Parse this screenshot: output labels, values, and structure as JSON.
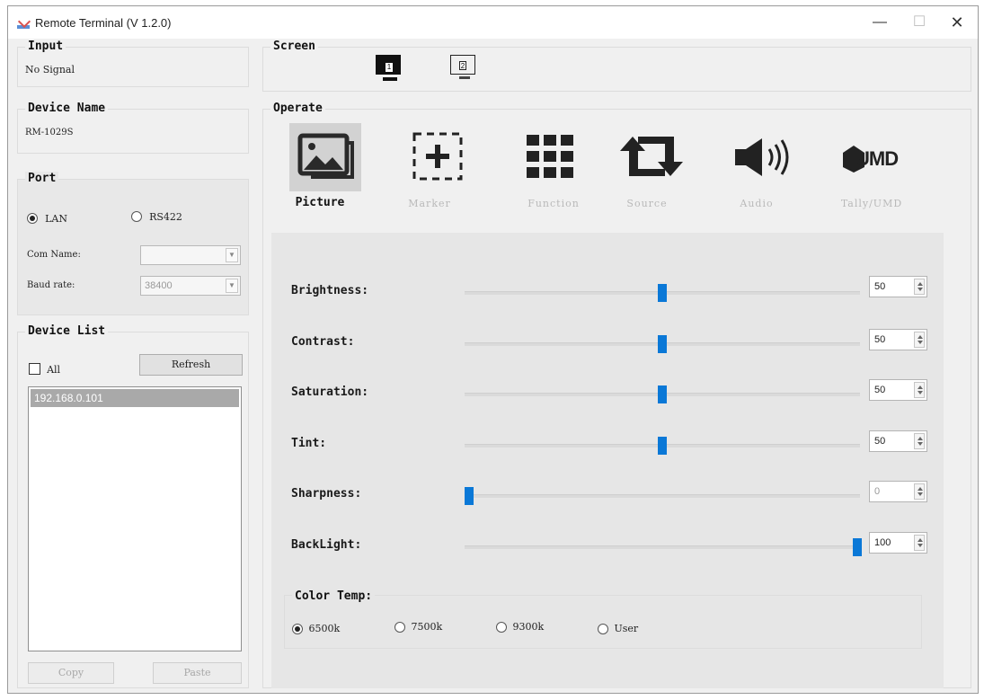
{
  "window": {
    "title": "Remote Terminal (V 1.2.0)",
    "minimize": "—",
    "maximize": "☐",
    "close": "✕"
  },
  "input": {
    "title": "Input",
    "value": "No Signal"
  },
  "device_name": {
    "title": "Device Name",
    "value": "RM-1029S"
  },
  "port": {
    "title": "Port",
    "options": [
      {
        "label": "LAN",
        "selected": true
      },
      {
        "label": "RS422",
        "selected": false
      }
    ],
    "com_name_label": "Com Name:",
    "com_name_value": "",
    "baud_rate_label": "Baud rate:",
    "baud_rate_value": "38400"
  },
  "device_list": {
    "title": "Device List",
    "all_label": "All",
    "refresh_label": "Refresh",
    "items": [
      "192.168.0.101"
    ],
    "copy_label": "Copy",
    "paste_label": "Paste"
  },
  "screen": {
    "title": "Screen",
    "screens": [
      "1",
      "2"
    ],
    "active": "1"
  },
  "operate": {
    "title": "Operate",
    "tabs": [
      {
        "label": "Picture",
        "active": true
      },
      {
        "label": "Marker",
        "active": false
      },
      {
        "label": "Function",
        "active": false
      },
      {
        "label": "Source",
        "active": false
      },
      {
        "label": "Audio",
        "active": false
      },
      {
        "label": "Tally/UMD",
        "active": false
      }
    ],
    "umd_icon_text": "UMD"
  },
  "picture": {
    "sliders": [
      {
        "label": "Brightness:",
        "value": "50",
        "level": 0.5
      },
      {
        "label": "Contrast:",
        "value": "50",
        "level": 0.5
      },
      {
        "label": "Saturation:",
        "value": "50",
        "level": 0.5
      },
      {
        "label": "Tint:",
        "value": "50",
        "level": 0.5
      },
      {
        "label": "Sharpness:",
        "value": "0",
        "level": 0.0
      },
      {
        "label": "BackLight:",
        "value": "100",
        "level": 1.0
      }
    ],
    "color_temp": {
      "title": "Color Temp:",
      "options": [
        {
          "label": "6500k",
          "selected": true
        },
        {
          "label": "7500k",
          "selected": false
        },
        {
          "label": "9300k",
          "selected": false
        },
        {
          "label": "User",
          "selected": false
        }
      ]
    }
  },
  "colors": {
    "accent": "#0a78d7",
    "panel": "#f0f0f0",
    "selected_item": "#a9a9a9"
  }
}
